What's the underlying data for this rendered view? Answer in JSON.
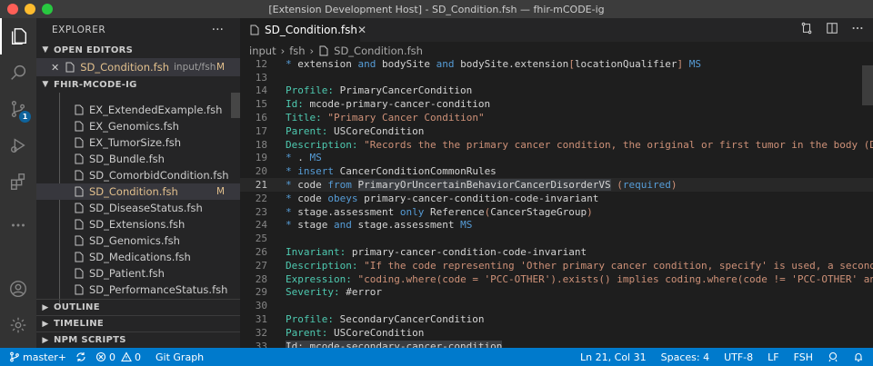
{
  "window": {
    "title": "[Extension Development Host] - SD_Condition.fsh — fhir-mCODE-ig"
  },
  "activity": {
    "scm_badge": "1"
  },
  "sidebar": {
    "title": "EXPLORER",
    "more": "···",
    "open_editors": {
      "header": "OPEN EDITORS",
      "item": {
        "name": "SD_Condition.fsh",
        "path": "input/fsh",
        "status": "M"
      }
    },
    "folder": {
      "header": "FHIR-MCODE-IG",
      "files": [
        {
          "name": "EX_ExtendedExample.fsh",
          "status": ""
        },
        {
          "name": "EX_Genomics.fsh",
          "status": ""
        },
        {
          "name": "EX_TumorSize.fsh",
          "status": ""
        },
        {
          "name": "SD_Bundle.fsh",
          "status": ""
        },
        {
          "name": "SD_ComorbidCondition.fsh",
          "status": ""
        },
        {
          "name": "SD_Condition.fsh",
          "status": "M"
        },
        {
          "name": "SD_DiseaseStatus.fsh",
          "status": ""
        },
        {
          "name": "SD_Extensions.fsh",
          "status": ""
        },
        {
          "name": "SD_Genomics.fsh",
          "status": ""
        },
        {
          "name": "SD_Medications.fsh",
          "status": ""
        },
        {
          "name": "SD_Patient.fsh",
          "status": ""
        },
        {
          "name": "SD_PerformanceStatus.fsh",
          "status": ""
        }
      ]
    },
    "outline": "OUTLINE",
    "timeline": "TIMELINE",
    "npm": "NPM SCRIPTS"
  },
  "editor": {
    "tab": "SD_Condition.fsh",
    "breadcrumbs": [
      "input",
      "fsh",
      "SD_Condition.fsh"
    ],
    "lines": [
      {
        "n": "12",
        "segs": [
          [
            "kw",
            "* "
          ],
          [
            "",
            ""
          ],
          [
            "",
            "extension "
          ],
          [
            "kw",
            "and"
          ],
          [
            "",
            " bodySite "
          ],
          [
            "kw",
            "and"
          ],
          [
            "",
            " bodySite.extension"
          ],
          [
            "str",
            "["
          ],
          [
            "",
            "locationQualifier"
          ],
          [
            "str",
            "]"
          ],
          [
            "",
            " "
          ],
          [
            "kw",
            "MS"
          ]
        ]
      },
      {
        "n": "13",
        "segs": []
      },
      {
        "n": "14",
        "segs": [
          [
            "lbl",
            "Profile:"
          ],
          [
            "",
            " PrimaryCancerCondition"
          ]
        ]
      },
      {
        "n": "15",
        "segs": [
          [
            "lbl",
            "Id:"
          ],
          [
            "",
            " mcode-primary-cancer-condition"
          ]
        ]
      },
      {
        "n": "16",
        "segs": [
          [
            "lbl",
            "Title:"
          ],
          [
            "",
            " "
          ],
          [
            "str",
            "\"Primary Cancer Condition\""
          ]
        ]
      },
      {
        "n": "17",
        "segs": [
          [
            "lbl",
            "Parent:"
          ],
          [
            "",
            " USCoreCondition"
          ]
        ]
      },
      {
        "n": "18",
        "segs": [
          [
            "lbl",
            "Description:"
          ],
          [
            "",
            " "
          ],
          [
            "str",
            "\"Records the the primary cancer condition, the original or first tumor in the body (Definitio"
          ]
        ]
      },
      {
        "n": "19",
        "segs": [
          [
            "kw",
            "* "
          ],
          [
            "",
            ". "
          ],
          [
            "kw",
            "MS"
          ]
        ]
      },
      {
        "n": "20",
        "segs": [
          [
            "kw",
            "* "
          ],
          [
            "kw",
            "insert"
          ],
          [
            "",
            " CancerConditionCommonRules"
          ]
        ]
      },
      {
        "n": "21",
        "segs": [
          [
            "kw",
            "* "
          ],
          [
            "",
            "code "
          ],
          [
            "kw",
            "from"
          ],
          [
            "",
            " "
          ],
          [
            "hl",
            "PrimaryOrUncertainBehaviorCancerDisorderVS"
          ],
          [
            "",
            " "
          ],
          [
            "str",
            "("
          ],
          [
            "kw",
            "required"
          ],
          [
            "str",
            ")"
          ]
        ],
        "current": true
      },
      {
        "n": "22",
        "segs": [
          [
            "kw",
            "* "
          ],
          [
            "",
            "code "
          ],
          [
            "kw",
            "obeys"
          ],
          [
            "",
            " primary-cancer-condition-code-invariant"
          ]
        ]
      },
      {
        "n": "23",
        "segs": [
          [
            "kw",
            "* "
          ],
          [
            "",
            "stage.assessment "
          ],
          [
            "kw",
            "only"
          ],
          [
            "",
            " Reference"
          ],
          [
            "str",
            "("
          ],
          [
            "",
            "CancerStageGroup"
          ],
          [
            "str",
            ")"
          ]
        ]
      },
      {
        "n": "24",
        "segs": [
          [
            "kw",
            "* "
          ],
          [
            "",
            "stage "
          ],
          [
            "kw",
            "and"
          ],
          [
            "",
            " stage.assessment "
          ],
          [
            "kw",
            "MS"
          ]
        ]
      },
      {
        "n": "25",
        "segs": []
      },
      {
        "n": "26",
        "segs": [
          [
            "lbl",
            "Invariant:"
          ],
          [
            "",
            " primary-cancer-condition-code-invariant"
          ]
        ]
      },
      {
        "n": "27",
        "segs": [
          [
            "lbl",
            "Description:"
          ],
          [
            "",
            " "
          ],
          [
            "str",
            "\"If the code representing 'Other primary cancer condition, specify' is used, a second code fr"
          ]
        ]
      },
      {
        "n": "28",
        "segs": [
          [
            "lbl",
            "Expression:"
          ],
          [
            "",
            " "
          ],
          [
            "str",
            "\"coding.where(code = 'PCC-OTHER').exists() implies coding.where(code != 'PCC-OTHER' and $this."
          ]
        ]
      },
      {
        "n": "29",
        "segs": [
          [
            "lbl",
            "Severity:"
          ],
          [
            "",
            " #error"
          ]
        ]
      },
      {
        "n": "30",
        "segs": []
      },
      {
        "n": "31",
        "segs": [
          [
            "lbl",
            "Profile:"
          ],
          [
            "",
            " SecondaryCancerCondition"
          ]
        ]
      },
      {
        "n": "32",
        "segs": [
          [
            "lbl",
            "Parent:"
          ],
          [
            "",
            " USCoreCondition"
          ]
        ]
      },
      {
        "n": "33",
        "segs": [
          [
            "hl",
            "Id: mcode-secondary-cancer-condition"
          ]
        ]
      }
    ]
  },
  "status": {
    "branch": "master+",
    "errors": "0",
    "warnings": "0",
    "git_graph": "Git Graph",
    "position": "Ln 21, Col 31",
    "spaces": "Spaces: 4",
    "encoding": "UTF-8",
    "eol": "LF",
    "language": "FSH"
  },
  "colors": {
    "accent": "#007acc",
    "modified": "#e2c08d",
    "label": "#4ec9b0",
    "keyword": "#569cd6",
    "string": "#ce9178"
  }
}
